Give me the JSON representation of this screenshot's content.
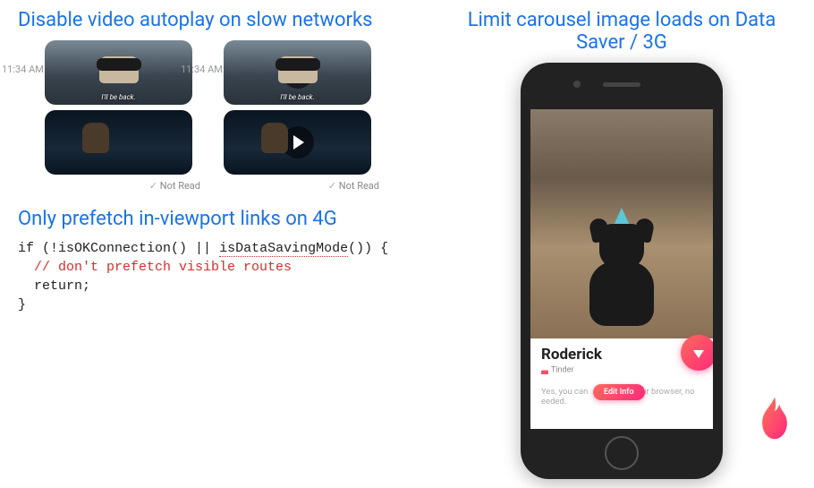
{
  "left": {
    "title1": "Disable video autoplay on slow networks",
    "timestamp": "11:34 AM",
    "subtitle": "I'll be back.",
    "not_read": "Not Read",
    "title2": "Only prefetch in-viewport links on 4G",
    "code": {
      "l1a": "if (!",
      "l1b": "isOKConnection",
      "l1c": "() || ",
      "l1d": "isDataSavingMode",
      "l1e": "()) {",
      "l2": "// don't prefetch visible routes",
      "l3": "return;",
      "l4": "}"
    }
  },
  "right": {
    "title": "Limit carousel image loads on Data Saver / 3G",
    "profile_name": "Roderick",
    "brand": "Tinder",
    "msg_before": "Yes, you can",
    "msg_after": "in your browser, no",
    "msg_tail": "eeded.",
    "edit_label": "Edit Info"
  }
}
